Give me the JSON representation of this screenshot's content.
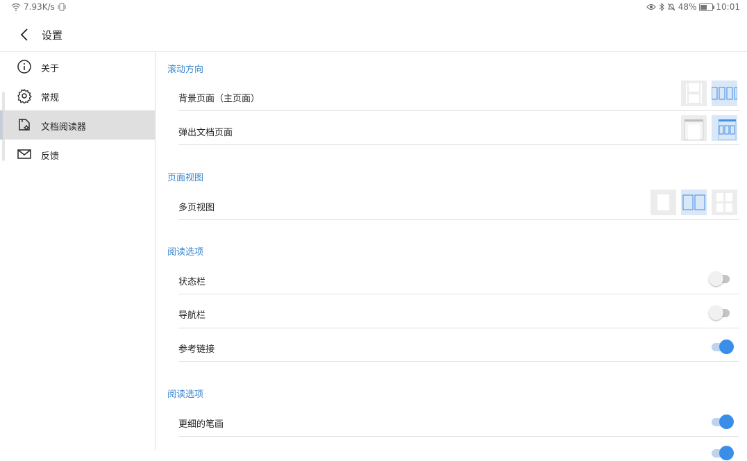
{
  "status": {
    "net_speed": "7.93K/s",
    "battery": "48%",
    "time": "10:01"
  },
  "header": {
    "title": "设置"
  },
  "sidebar": {
    "items": [
      {
        "label": "关于",
        "icon": "info-icon"
      },
      {
        "label": "常规",
        "icon": "gear-icon"
      },
      {
        "label": "文档阅读器",
        "icon": "document-settings-icon",
        "active": true
      },
      {
        "label": "反馈",
        "icon": "mail-icon"
      }
    ]
  },
  "main": {
    "scroll_direction": {
      "title": "滚动方向",
      "background_page": {
        "label": "背景页面（主页面）",
        "options": [
          "vertical",
          "horizontal"
        ],
        "selected": "horizontal"
      },
      "popup_page": {
        "label": "弹出文档页面",
        "options": [
          "vertical",
          "horizontal"
        ],
        "selected": "horizontal"
      }
    },
    "page_view": {
      "title": "页面视图",
      "multi_page": {
        "label": "多页视图",
        "options": [
          "single",
          "double",
          "grid"
        ],
        "selected": "double"
      }
    },
    "reading_options": {
      "title": "阅读选项",
      "status_bar": {
        "label": "状态栏",
        "on": false
      },
      "nav_bar": {
        "label": "导航栏",
        "on": false
      },
      "ref_links": {
        "label": "参考链接",
        "on": true
      }
    },
    "reading_options_2": {
      "title": "阅读选项",
      "thin_strokes": {
        "label": "更细的笔画",
        "on": true
      }
    }
  },
  "colors": {
    "accent": "#3a86cf",
    "toggle_on": "#3b8ee8",
    "active_bg": "#dfdfdf"
  }
}
